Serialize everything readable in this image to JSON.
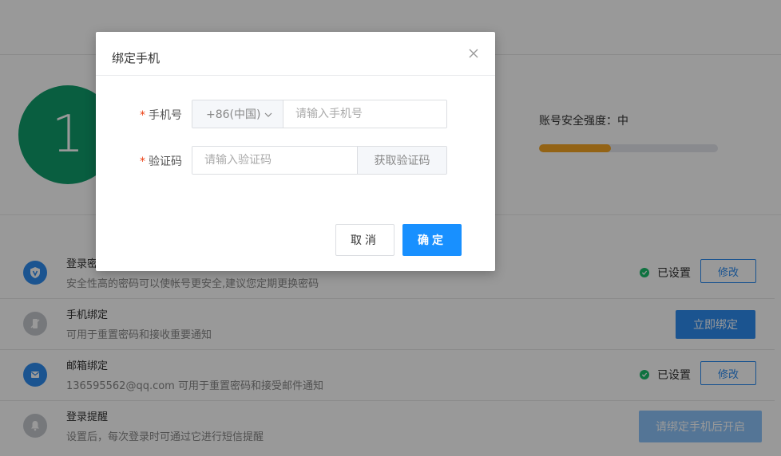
{
  "background_page": {
    "score": "1",
    "security_strength_label": "账号安全强度：中",
    "security_strength_fraction": 0.4,
    "rows": [
      {
        "icon": "shield-v-icon",
        "title": "登录密码",
        "description": "安全性高的密码可以使帐号更安全,建议您定期更换密码",
        "status": "已设置",
        "action": "修改"
      },
      {
        "icon": "phone-icon",
        "title": "手机绑定",
        "description": "可用于重置密码和接收重要通知",
        "action": "立即绑定"
      },
      {
        "icon": "mail-icon",
        "title": "邮箱绑定",
        "description": "136595562@qq.com 可用于重置密码和接受邮件通知",
        "status": "已设置",
        "action": "修改"
      },
      {
        "icon": "bell-icon",
        "title": "登录提醒",
        "description": "设置后，每次登录时可通过它进行短信提醒",
        "action": "请绑定手机后开启"
      }
    ]
  },
  "modal": {
    "title": "绑定手机",
    "phone_label": "手机号",
    "country_code": "+86(中国)",
    "phone_placeholder": "请输入手机号",
    "code_label": "验证码",
    "code_placeholder": "请输入验证码",
    "get_code_label": "获取验证码",
    "cancel_label": "取消",
    "confirm_label": "确定"
  },
  "colors": {
    "score_circle": "#0f9d6b",
    "strength_fill": "#f5a623",
    "primary": "#1890ff",
    "set_dot": "#19be6b"
  }
}
